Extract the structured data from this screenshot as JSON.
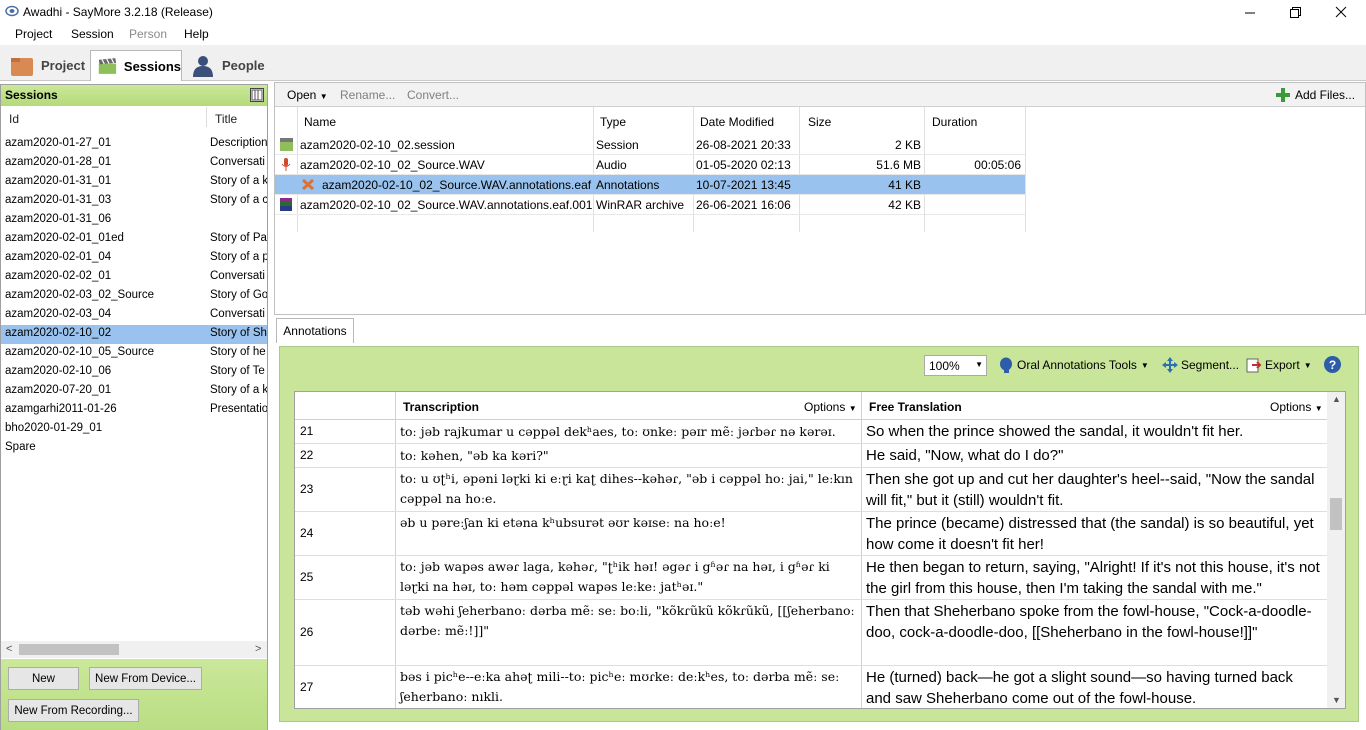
{
  "window": {
    "title": "Awadhi - SayMore 3.2.18 (Release)",
    "minimize": "—",
    "restore": "❐",
    "close": "✕"
  },
  "menu": {
    "project": "Project",
    "session": "Session",
    "person": "Person",
    "help": "Help"
  },
  "tabs": {
    "project": "Project",
    "sessions": "Sessions",
    "people": "People"
  },
  "sessions": {
    "header": "Sessions",
    "col_id": "Id",
    "col_title": "Title",
    "rows": [
      {
        "id": "azam2020-01-27_01",
        "title": "Description"
      },
      {
        "id": "azam2020-01-28_01",
        "title": "Conversati"
      },
      {
        "id": "azam2020-01-31_01",
        "title": "Story of a k"
      },
      {
        "id": "azam2020-01-31_03",
        "title": "Story of a c"
      },
      {
        "id": "azam2020-01-31_06",
        "title": ""
      },
      {
        "id": "azam2020-02-01_01ed",
        "title": "Story of Pa"
      },
      {
        "id": "azam2020-02-01_04",
        "title": "Story of a p"
      },
      {
        "id": "azam2020-02-02_01",
        "title": "Conversati"
      },
      {
        "id": "azam2020-02-03_02_Source",
        "title": "Story of Go"
      },
      {
        "id": "azam2020-02-03_04",
        "title": "Conversati"
      },
      {
        "id": "azam2020-02-10_02",
        "title": "Story of Sh"
      },
      {
        "id": "azam2020-02-10_05_Source",
        "title": "Story of he"
      },
      {
        "id": "azam2020-02-10_06",
        "title": "Story of Te"
      },
      {
        "id": "azam2020-07-20_01",
        "title": "Story of a k"
      },
      {
        "id": "azamgarhi2011-01-26",
        "title": "Presentatio"
      },
      {
        "id": "bho2020-01-29_01",
        "title": ""
      },
      {
        "id": "Spare",
        "title": ""
      }
    ],
    "scroll_left": "<",
    "scroll_right": ">",
    "btn_new": "New",
    "btn_new_device": "New From Device...",
    "btn_new_recording": "New From Recording..."
  },
  "files": {
    "toolbar": {
      "open": "Open",
      "rename": "Rename...",
      "convert": "Convert...",
      "add_files": "Add Files..."
    },
    "headers": {
      "name": "Name",
      "type": "Type",
      "date": "Date Modified",
      "size": "Size",
      "duration": "Duration"
    },
    "rows": [
      {
        "name": "azam2020-02-10_02.session",
        "type": "Session",
        "date": "26-08-2021 20:33",
        "size": "2 KB",
        "duration": "",
        "icon": "session-icon"
      },
      {
        "name": "azam2020-02-10_02_Source.WAV",
        "type": "Audio",
        "date": "01-05-2020 02:13",
        "size": "51.6 MB",
        "duration": "00:05:06",
        "icon": "audio-icon"
      },
      {
        "name": "azam2020-02-10_02_Source.WAV.annotations.eaf",
        "type": "Annotations",
        "date": "10-07-2021 13:45",
        "size": "41 KB",
        "duration": "",
        "icon": "annotations-icon"
      },
      {
        "name": "azam2020-02-10_02_Source.WAV.annotations.eaf.001",
        "type": "WinRAR archive",
        "date": "26-06-2021 16:06",
        "size": "42 KB",
        "duration": "",
        "icon": "winrar-icon"
      }
    ]
  },
  "annotations": {
    "tab": "Annotations",
    "zoom": "100%",
    "oral_tools": "Oral Annotations Tools",
    "segment": "Segment...",
    "export": "Export",
    "help": "?",
    "col_transcription": "Transcription",
    "col_free": "Free Translation",
    "options": "Options",
    "rows": [
      {
        "num": "21",
        "trans": "toː jəb rajkumar u cəppəl dekʰaes, toː ʊnkeː pəɪr mẽː jəɾbəɾ nə kərəɪ.",
        "free": "So when the prince showed the sandal, it wouldn't fit her."
      },
      {
        "num": "22",
        "trans": "toː kəhen, \"əb ka kəri?\"",
        "free": "He said, \"Now, what do I do?\""
      },
      {
        "num": "23",
        "trans": "toː u ʊʈʰi, əpəni ləɽki ki eːɽi kaʈ dihes--kəhəɾ, \"əb i cəppəl hoː jai,\" leːkın cəppəl na hoːe.",
        "free": "Then she got up and cut her daughter's heel--said, \"Now the sandal will fit,\" but it (still) wouldn't fit."
      },
      {
        "num": "24",
        "trans": "əb u pəreːʃan ki etəna kʰubsurət əʊr kəɪseː na hoːe!",
        "free": "The prince (became) distressed that (the sandal) is so beautiful, yet how come it doesn't fit her!"
      },
      {
        "num": "25",
        "trans": "toː jəb wapəs awəɾ laga, kəhəɾ, \"ʈʰik həɪ! əgəɾ i gʱəɾ na həɪ, i gʱəɾ ki ləɽki na həɪ, toː həm cəppəl wapəs leːkeː jatʰəɪ.\"",
        "free": "He then began to return, saying, \"Alright! If it's not this house, it's not the girl from this house, then I'm taking the sandal with me.\""
      },
      {
        "num": "26",
        "trans": "təb wəhi ʃeherbanoː dərba mẽː seː boːli, \"kõkɾũkũ kõkɾũkũ, [[ʃeherbanoː dərbeː mẽː!]]\"",
        "free": "Then that Sheherbano spoke from the fowl-house, \"Cock-a-doodle-doo, cock-a-doodle-doo, [[Sheherbano in the fowl-house!]]\""
      },
      {
        "num": "27",
        "trans": "bəs i picʰe--eːka ahəʈ mili--toː picʰeː mʊɾkeː deːkʰes, toː dərba mẽː seː ʃeherbanoː nıkli.",
        "free": "He (turned) back—he got a slight sound—so having turned back and saw Sheherbano come out of the fowl-house."
      }
    ]
  }
}
